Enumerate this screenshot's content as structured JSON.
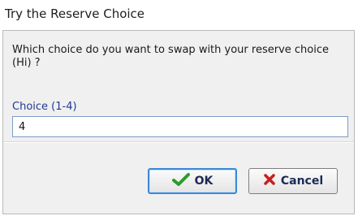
{
  "window": {
    "title": "Try the Reserve Choice"
  },
  "dialog": {
    "question": "Which choice do you want to swap with your reserve choice (Hi) ?",
    "field_label": "Choice (1-4)",
    "field_value": "4",
    "ok_label": "OK",
    "cancel_label": "Cancel"
  },
  "colors": {
    "ok_check": "#2a9d2a",
    "cancel_x": "#c81e1e",
    "field_label": "#1f3a93",
    "focus_border": "#3d88d6"
  },
  "icons": {
    "ok": "checkmark-icon",
    "cancel": "x-icon"
  }
}
